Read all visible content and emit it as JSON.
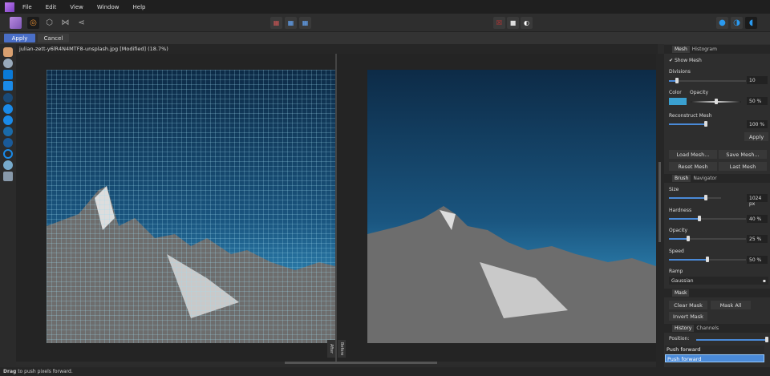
{
  "menu": [
    "File",
    "Edit",
    "View",
    "Window",
    "Help"
  ],
  "context": {
    "apply": "Apply",
    "cancel": "Cancel"
  },
  "document": {
    "title": "julian-zett-y6lR4N4MTF8-unsplash.jpg [Modified] (18.7%)",
    "after_label": "After",
    "before_label": "Before"
  },
  "mesh_panel": {
    "tabs": [
      "Mesh",
      "Histogram"
    ],
    "show_mesh": "Show Mesh",
    "divisions_label": "Divisions",
    "divisions_value": "10",
    "divisions": 0.1,
    "color_label": "Color",
    "opacity_label": "Opacity",
    "opacity_value": "50 %",
    "opacity": 0.5,
    "mesh_color": "#3aa0d0",
    "reconstruct_label": "Reconstruct Mesh",
    "reconstruct_value": "100 %",
    "reconstruct": 1.0,
    "apply": "Apply",
    "load": "Load Mesh...",
    "save": "Save Mesh...",
    "reset": "Reset Mesh",
    "last": "Last Mesh"
  },
  "brush_panel": {
    "tabs": [
      "Brush",
      "Navigator"
    ],
    "size_label": "Size",
    "size_value": "1024 px",
    "size": 0.7,
    "hardness_label": "Hardness",
    "hardness_value": "40 %",
    "hardness": 0.4,
    "opacity_label": "Opacity",
    "opacity_value": "25 %",
    "opacity": 0.25,
    "speed_label": "Speed",
    "speed_value": "50 %",
    "speed": 0.5,
    "ramp_label": "Ramp",
    "ramp_value": "Gaussian"
  },
  "mask_panel": {
    "tabs": [
      "Mask"
    ],
    "clear": "Clear Mask",
    "all": "Mask All",
    "invert": "Invert Mask"
  },
  "history_panel": {
    "tabs": [
      "History",
      "Channels"
    ],
    "position_label": "Position:",
    "position": 1.0,
    "items": [
      "Push forward",
      "Push forward"
    ]
  },
  "status": {
    "bold": "Drag",
    "text": " to push pixels forward."
  },
  "colors": {
    "accent": "#4a7fd8",
    "selection": "#4a8ad8"
  }
}
